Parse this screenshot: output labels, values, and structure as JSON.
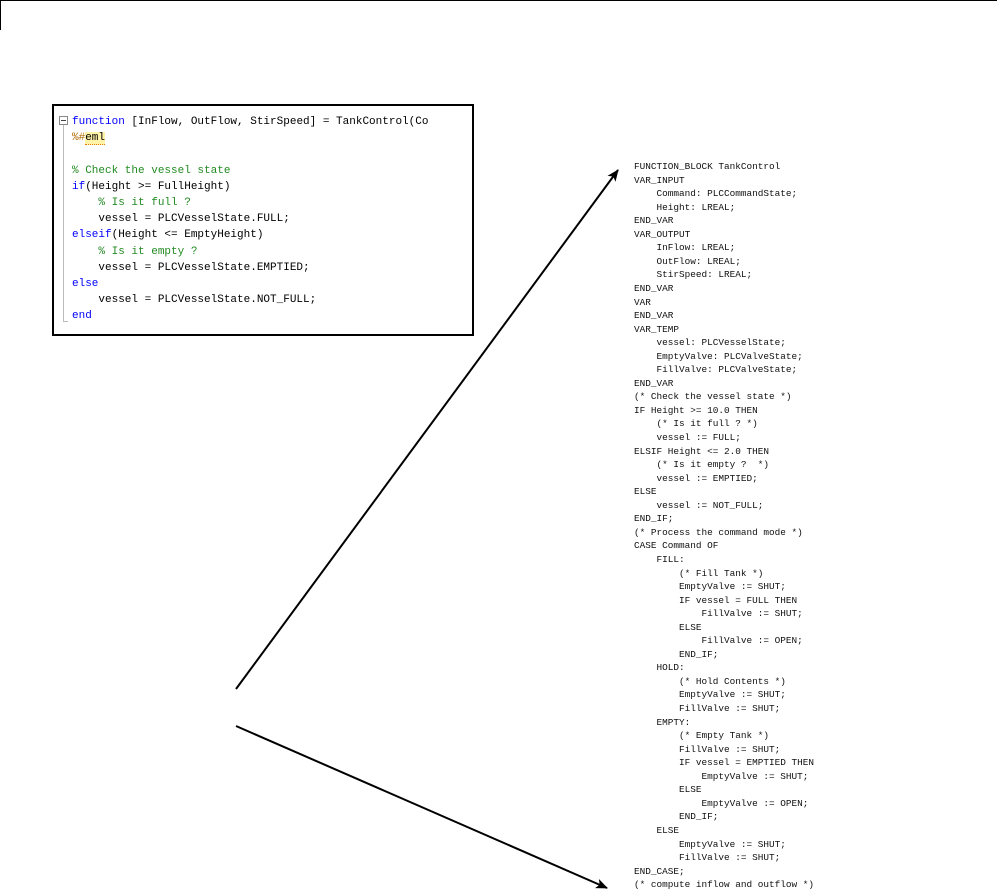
{
  "matlab_code": {
    "lines": [
      [
        {
          "t": "function",
          "c": "kw"
        },
        {
          "t": " [InFlow, OutFlow, StirSpeed] = TankControl(Co",
          "c": ""
        }
      ],
      [
        {
          "t": "%#",
          "c": "pr"
        },
        {
          "t": "eml",
          "c": "warn"
        }
      ],
      [],
      [
        {
          "t": "% Check the vessel state",
          "c": "cm"
        }
      ],
      [
        {
          "t": "if",
          "c": "kw"
        },
        {
          "t": "(Height >= FullHeight)",
          "c": ""
        }
      ],
      [
        {
          "t": "    % Is it full ?",
          "c": "cm"
        }
      ],
      [
        {
          "t": "    vessel = PLCVesselState.FULL;",
          "c": ""
        }
      ],
      [
        {
          "t": "elseif",
          "c": "kw"
        },
        {
          "t": "(Height <= EmptyHeight)",
          "c": ""
        }
      ],
      [
        {
          "t": "    % Is it empty ?",
          "c": "cm"
        }
      ],
      [
        {
          "t": "    vessel = PLCVesselState.EMPTIED;",
          "c": ""
        }
      ],
      [
        {
          "t": "else",
          "c": "kw"
        }
      ],
      [
        {
          "t": "    vessel = PLCVesselState.NOT_FULL;",
          "c": ""
        }
      ],
      [
        {
          "t": "end",
          "c": "kw"
        }
      ]
    ]
  },
  "structured_text": {
    "lines": [
      "FUNCTION_BLOCK TankControl",
      "VAR_INPUT",
      "    Command: PLCCommandState;",
      "    Height: LREAL;",
      "END_VAR",
      "VAR_OUTPUT",
      "    InFlow: LREAL;",
      "    OutFlow: LREAL;",
      "    StirSpeed: LREAL;",
      "END_VAR",
      "VAR",
      "END_VAR",
      "VAR_TEMP",
      "    vessel: PLCVesselState;",
      "    EmptyValve: PLCValveState;",
      "    FillValve: PLCValveState;",
      "END_VAR",
      "(* Check the vessel state *)",
      "IF Height >= 10.0 THEN",
      "    (* Is it full ? *)",
      "    vessel := FULL;",
      "ELSIF Height <= 2.0 THEN",
      "    (* Is it empty ?  *)",
      "    vessel := EMPTIED;",
      "ELSE",
      "    vessel := NOT_FULL;",
      "END_IF;",
      "(* Process the command mode *)",
      "CASE Command OF",
      "    FILL:",
      "        (* Fill Tank *)",
      "        EmptyValve := SHUT;",
      "        IF vessel = FULL THEN",
      "            FillValve := SHUT;",
      "        ELSE",
      "            FillValve := OPEN;",
      "        END_IF;",
      "    HOLD:",
      "        (* Hold Contents *)",
      "        EmptyValve := SHUT;",
      "        FillValve := SHUT;",
      "    EMPTY:",
      "        (* Empty Tank *)",
      "        FillValve := SHUT;",
      "        IF vessel = EMPTIED THEN",
      "            EmptyValve := SHUT;",
      "        ELSE",
      "            EmptyValve := OPEN;",
      "        END_IF;",
      "    ELSE",
      "        EmptyValve := SHUT;",
      "        FillValve := SHUT;",
      "END_CASE;",
      "(* compute inflow and outflow *)"
    ]
  },
  "colors": {
    "keyword": "#0000ff",
    "comment": "#228b22",
    "pragma": "#b36b00",
    "text": "#000000"
  }
}
